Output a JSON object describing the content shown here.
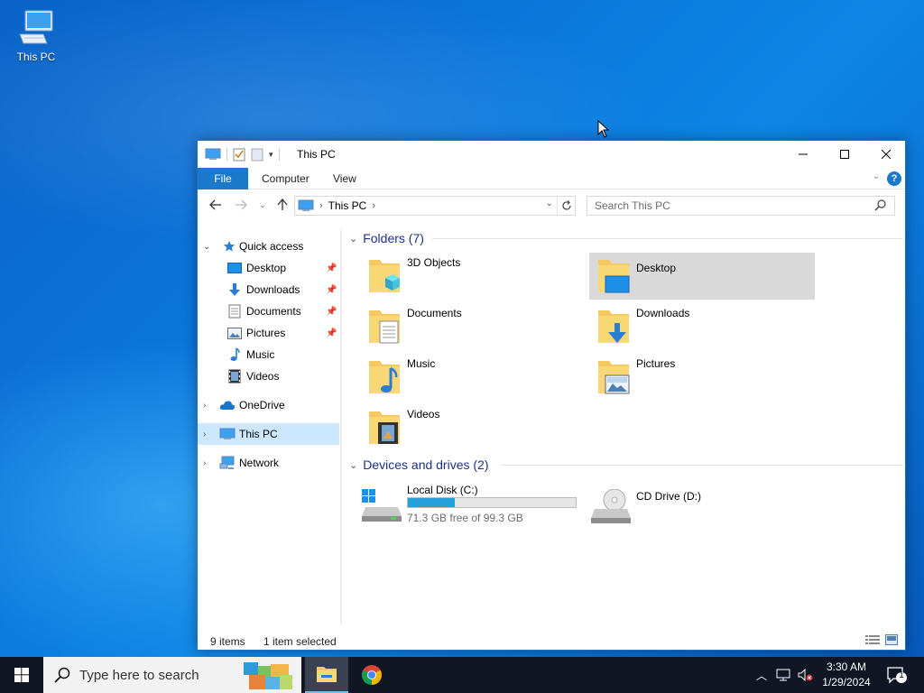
{
  "desktop": {
    "icon_label": "This PC"
  },
  "window": {
    "title": "This PC",
    "ribbon_tabs": [
      "File",
      "Computer",
      "View"
    ],
    "help_label": "?",
    "address": {
      "crumb": "This PC"
    },
    "search": {
      "placeholder": "Search This PC"
    }
  },
  "sidebar": {
    "quick_access": "Quick access",
    "items": [
      {
        "label": "Desktop",
        "icon": "desktop-icon",
        "pinned": true
      },
      {
        "label": "Downloads",
        "icon": "downloads-icon",
        "pinned": true
      },
      {
        "label": "Documents",
        "icon": "documents-icon",
        "pinned": true
      },
      {
        "label": "Pictures",
        "icon": "pictures-icon",
        "pinned": true
      },
      {
        "label": "Music",
        "icon": "music-icon",
        "pinned": false
      },
      {
        "label": "Videos",
        "icon": "videos-icon",
        "pinned": false
      }
    ],
    "onedrive": "OneDrive",
    "this_pc": "This PC",
    "network": "Network"
  },
  "content": {
    "folders_header": "Folders (7)",
    "folders": [
      {
        "name": "3D Objects",
        "icon": "3d-objects-folder-icon"
      },
      {
        "name": "Desktop",
        "icon": "desktop-folder-icon",
        "selected": true
      },
      {
        "name": "Documents",
        "icon": "documents-folder-icon"
      },
      {
        "name": "Downloads",
        "icon": "downloads-folder-icon"
      },
      {
        "name": "Music",
        "icon": "music-folder-icon"
      },
      {
        "name": "Pictures",
        "icon": "pictures-folder-icon"
      },
      {
        "name": "Videos",
        "icon": "videos-folder-icon"
      }
    ],
    "drives_header": "Devices and drives (2)",
    "drives": [
      {
        "name": "Local Disk (C:)",
        "free_text": "71.3 GB free of 99.3 GB",
        "used_fraction": 0.282
      },
      {
        "name": "CD Drive (D:)"
      }
    ]
  },
  "status": {
    "items": "9 items",
    "selected": "1 item selected"
  },
  "taskbar": {
    "search_placeholder": "Type here to search",
    "time": "3:30 AM",
    "date": "1/29/2024",
    "notification_count": "1"
  },
  "colors": {
    "accent": "#1979ca",
    "selection": "#cce8ff",
    "header_text": "#1e3287",
    "drive_bar": "#26a0da"
  }
}
